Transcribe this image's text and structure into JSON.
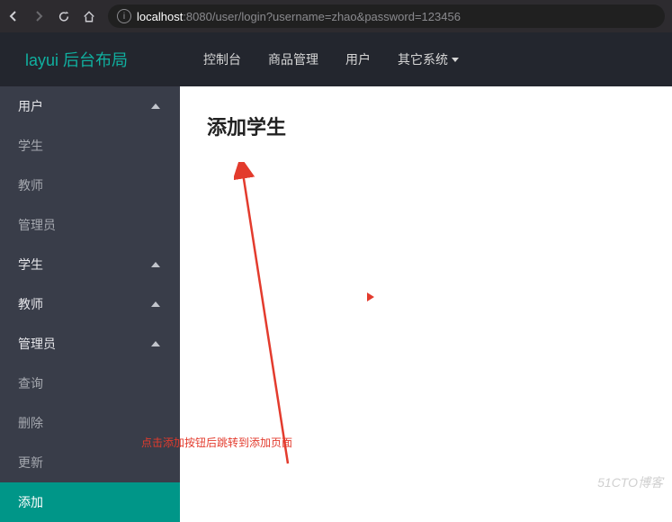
{
  "browser": {
    "url_host": "localhost",
    "url_rest": ":8080/user/login?username=zhao&password=123456"
  },
  "brand": "layui 后台布局",
  "top_nav": [
    {
      "label": "控制台"
    },
    {
      "label": "商品管理"
    },
    {
      "label": "用户"
    },
    {
      "label": "其它系统",
      "dropdown": true
    }
  ],
  "sidebar": [
    {
      "label": "用户",
      "type": "group",
      "expanded": true
    },
    {
      "label": "学生",
      "type": "sub"
    },
    {
      "label": "教师",
      "type": "sub"
    },
    {
      "label": "管理员",
      "type": "sub"
    },
    {
      "label": "学生",
      "type": "group",
      "expanded": true
    },
    {
      "label": "教师",
      "type": "group",
      "expanded": true
    },
    {
      "label": "管理员",
      "type": "group",
      "expanded": true
    },
    {
      "label": "查询",
      "type": "sub"
    },
    {
      "label": "删除",
      "type": "sub"
    },
    {
      "label": "更新",
      "type": "sub"
    },
    {
      "label": "添加",
      "type": "sub",
      "active": true
    }
  ],
  "main": {
    "title": "添加学生"
  },
  "annotation": {
    "text": "点击添加按钮后跳转到添加页面"
  },
  "watermark": "51CTO博客"
}
